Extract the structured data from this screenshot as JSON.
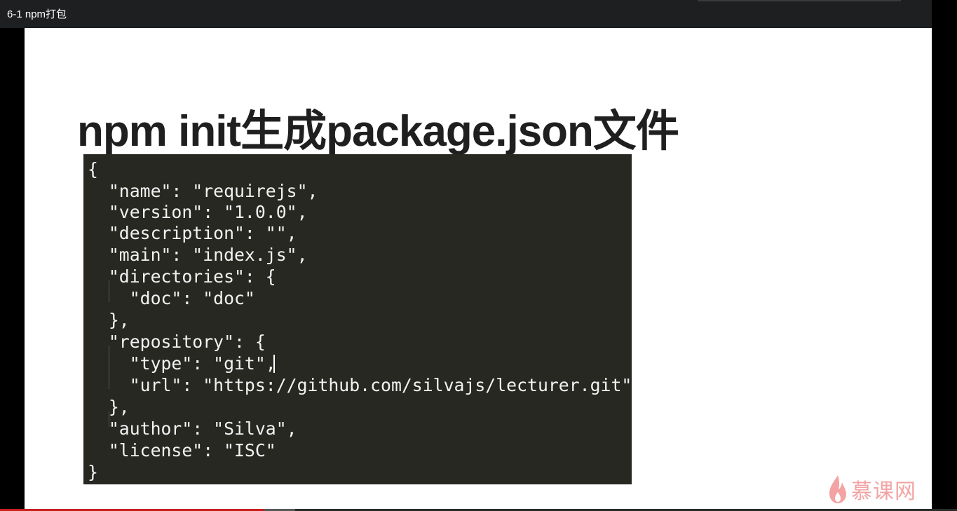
{
  "window": {
    "title": "6-1 npm打包"
  },
  "slide": {
    "title": "npm init生成package.json文件",
    "ghost_text": "| | | |",
    "code_lines": [
      "{",
      "  \"name\": \"requirejs\",",
      "  \"version\": \"1.0.0\",",
      "  \"description\": \"\",",
      "  \"main\": \"index.js\",",
      "  \"directories\": {",
      "    \"doc\": \"doc\"",
      "  },",
      "  \"repository\": {",
      "    \"type\": \"git\",",
      "    \"url\": \"https://github.com/silvajs/lecturer.git\"",
      "  },",
      "  \"author\": \"Silva\",",
      "  \"license\": \"ISC\"",
      "}"
    ]
  },
  "logo": {
    "text": "慕课网",
    "icon": "flame-icon"
  },
  "player": {
    "progress_fraction": 0.276,
    "buffered_fraction": 0.308
  },
  "colors": {
    "code_bg": "#272822",
    "code_text": "#f2f2f2",
    "title_text": "#1f1f1f",
    "logo": "#f3a3a3",
    "progress": "#c8201d"
  }
}
